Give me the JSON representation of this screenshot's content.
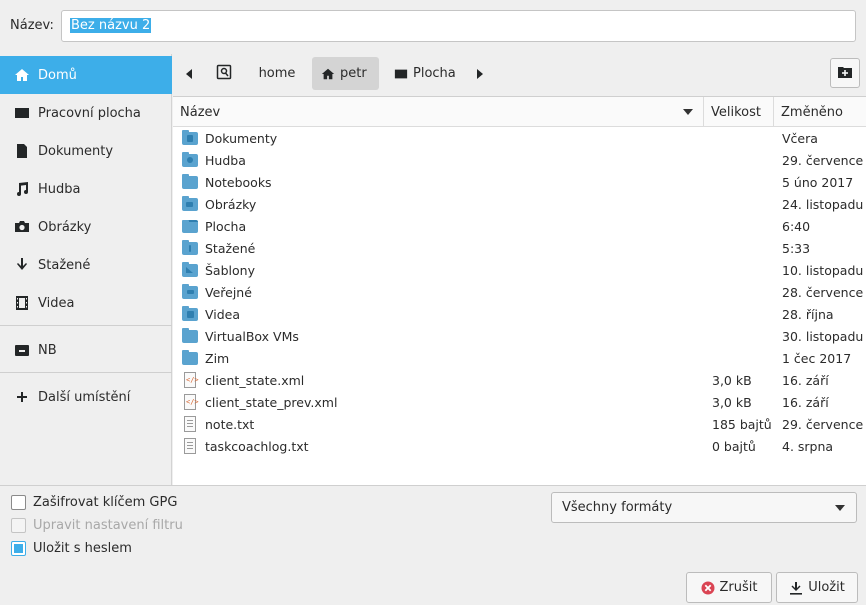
{
  "name_row": {
    "label": "Název:",
    "value": "Bez názvu 2"
  },
  "sidebar": {
    "items": [
      {
        "label": "Domů",
        "icon": "home-icon",
        "active": true
      },
      {
        "label": "Pracovní plocha",
        "icon": "desktop-icon"
      },
      {
        "label": "Dokumenty",
        "icon": "document-icon"
      },
      {
        "label": "Hudba",
        "icon": "music-icon"
      },
      {
        "label": "Obrázky",
        "icon": "camera-icon"
      },
      {
        "label": "Stažené",
        "icon": "download-icon"
      },
      {
        "label": "Videa",
        "icon": "film-icon"
      },
      {
        "label": "NB",
        "icon": "drive-icon"
      },
      {
        "label": "Další umístění",
        "icon": "plus-icon"
      }
    ]
  },
  "pathbar": {
    "crumbs": [
      "home",
      "petr",
      "Plocha"
    ],
    "active_crumb": "petr"
  },
  "filelist": {
    "columns": [
      "Název",
      "Velikost",
      "Změněno"
    ],
    "rows": [
      {
        "name": "Dokumenty",
        "size": "",
        "modified": "Včera",
        "kind": "folder"
      },
      {
        "name": "Hudba",
        "size": "",
        "modified": "29. července",
        "kind": "folder"
      },
      {
        "name": "Notebooks",
        "size": "",
        "modified": "5 úno 2017",
        "kind": "folder"
      },
      {
        "name": "Obrázky",
        "size": "",
        "modified": "24. listopadu",
        "kind": "folder"
      },
      {
        "name": "Plocha",
        "size": "",
        "modified": "6:40",
        "kind": "folder"
      },
      {
        "name": "Stažené",
        "size": "",
        "modified": "5:33",
        "kind": "folder"
      },
      {
        "name": "Šablony",
        "size": "",
        "modified": "10. listopadu",
        "kind": "folder"
      },
      {
        "name": "Veřejné",
        "size": "",
        "modified": "28. července",
        "kind": "folder"
      },
      {
        "name": "Videa",
        "size": "",
        "modified": "28. října",
        "kind": "folder"
      },
      {
        "name": "VirtualBox VMs",
        "size": "",
        "modified": "30. listopadu",
        "kind": "folder"
      },
      {
        "name": "Zim",
        "size": "",
        "modified": "1 čec 2017",
        "kind": "folder"
      },
      {
        "name": "client_state.xml",
        "size": "3,0 kB",
        "modified": "16. září",
        "kind": "xml"
      },
      {
        "name": "client_state_prev.xml",
        "size": "3,0 kB",
        "modified": "16. září",
        "kind": "xml"
      },
      {
        "name": "note.txt",
        "size": "185 bajtů",
        "modified": "29. července",
        "kind": "txt"
      },
      {
        "name": "taskcoachlog.txt",
        "size": "0 bajtů",
        "modified": "4. srpna",
        "kind": "txt"
      }
    ]
  },
  "options": {
    "encrypt_gpg": "Zašifrovat klíčem GPG",
    "edit_filter": "Upravit nastavení filtru",
    "save_with_password": "Uložit s heslem"
  },
  "format_select": {
    "value": "Všechny formáty"
  },
  "buttons": {
    "cancel": "Zrušit",
    "save": "Uložit"
  },
  "colors": {
    "accent": "#3daee9",
    "folder": "#5aa3cf",
    "cancel_icon": "#da4453"
  }
}
